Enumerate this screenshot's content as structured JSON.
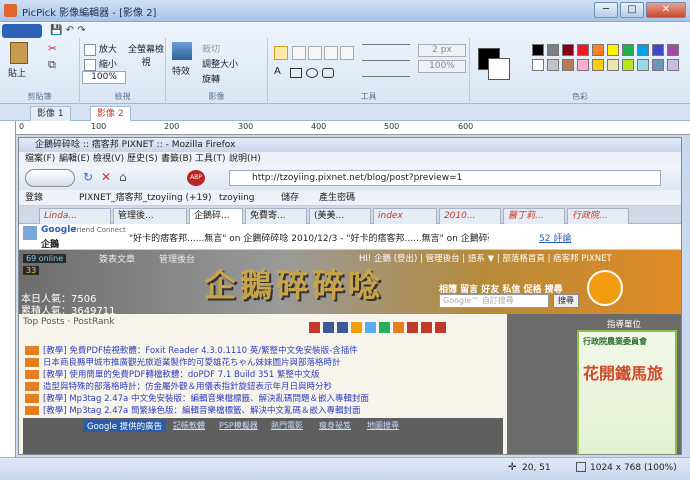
{
  "window": {
    "title": "PicPick 影像編輯器 - [影像 2]",
    "min": "─",
    "max": "□",
    "close": "✕"
  },
  "ribbon": {
    "clipboard": {
      "paste": "貼上",
      "cut": "✂",
      "copy": "⧉",
      "group": "剪貼簿"
    },
    "view": {
      "zoom_in": "放大",
      "zoom_out": "縮小",
      "zoom": "100%",
      "fullscreen": "全螢幕檢視",
      "group": "檢視"
    },
    "image": {
      "effects": "特效",
      "crop": "裁切",
      "resize": "調整大小",
      "rotate": "旋轉",
      "group": "影像"
    },
    "tools": {
      "group": "工具",
      "size": "2 px",
      "opacity": "100%"
    },
    "colors": {
      "group": "色彩",
      "palette": [
        "#000000",
        "#7f7f7f",
        "#880015",
        "#ed1c24",
        "#ff7f27",
        "#fff200",
        "#22b14c",
        "#00a2e8",
        "#3f48cc",
        "#a349a4",
        "#ffffff",
        "#c3c3c3",
        "#b97a57",
        "#ffaec9",
        "#ffc90e",
        "#efe4b0",
        "#b5e61d",
        "#99d9ea",
        "#7092be",
        "#c8bfe7"
      ]
    }
  },
  "doc_tabs": [
    "影像 1",
    "影像 2"
  ],
  "ruler": {
    "marks": [
      "0",
      "100",
      "200",
      "300",
      "400",
      "500",
      "600"
    ]
  },
  "firefox": {
    "title": "企鵝碎碎唸 :: 痞客邦 PIXNET :: - Mozilla Firefox",
    "menu": [
      "檔案(F)",
      "編輯(E)",
      "檢視(V)",
      "歷史(S)",
      "書籤(B)",
      "工具(T)",
      "說明(H)"
    ],
    "url": "http://tzoyiing.pixnet.net/blog/post?preview=1",
    "bookmarks": [
      "登錄",
      "PIXNET_痞客邦_tzoyiing (+19)",
      "tzoyiing",
      "儲存",
      "產生密碼"
    ],
    "tabs": [
      "Linda...",
      "管理後...",
      "企鵝碎...",
      "免費寄...",
      "(美美...",
      "index",
      "2010...",
      "醫丁莉...",
      "行政院..."
    ],
    "gfc": {
      "brand": "Google",
      "sub": "Friend Connect",
      "name": "企鵝",
      "msg": "\"好卡的痞客邦......無言\" on 企鵝碎碎唸 2010/12/3 - \"好卡的痞客邦......無言\" on 企鵝碎碎唸",
      "comments": "52 評論"
    }
  },
  "blog": {
    "stats": [
      "69 online",
      "33"
    ],
    "nav": [
      "簽表文章",
      "管理後台"
    ],
    "login": "HI! 企鵝 (登出) | 管理後台 | 語系 ▼ | 部落格首頁 | 痞客邦 PIXNET",
    "title": "企鵝碎碎唸",
    "links": "相簿 留言 好友 私信 促格 搜尋",
    "visits_today": "本日人氣：7506",
    "visits_total": "累積人氣：3649711",
    "search_placeholder": "Google™ 自訂搜尋",
    "search_btn": "搜尋",
    "top_posts": "Top Posts · PostRank",
    "posts": [
      "[教學] 免費PDF檢視軟體：Foxit Reader 4.3.0.1110 英/繁整中文免安裝版-含插件",
      "日本商良縣甲城市推廣觀光旅遊業製作的可愛雄花ちゃん妹妹圖片與部落格時計",
      "[教學] 使用簡單的免費PDF轉檔軟體：doPDF 7.1 Build 351 繁整中文版",
      "造型與特殊的部落格時計：仿金屬外觀＆用儀表指針旋鈕表示年月日與時分秒",
      "[教學] Mp3tag 2.47a 中文免安裝版：編輯音樂檔標籤、解決亂碼問題＆嵌入專輯封面",
      "[教學] Mp3tag 2.47a 簡繁綠色版：編輯音樂檔標籤、解決中文亂碼＆嵌入專輯封面"
    ],
    "ads_label": "Google 提供的廣告",
    "ads": [
      "記帳軟體",
      "PSP模擬器",
      "熱門電影",
      "瘦身祕笈",
      "地圖搜尋"
    ],
    "sidebar_title": "指導單位",
    "sidebar_org": "行政院農業委員會",
    "sidebar_banner": "花開鐵馬旅"
  },
  "status": {
    "coords": "20, 51",
    "size": "1024 x 768 (100%)"
  }
}
